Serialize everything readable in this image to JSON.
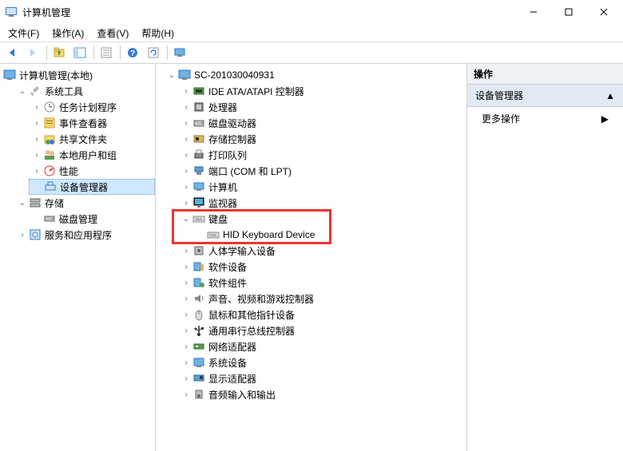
{
  "window": {
    "title": "计算机管理",
    "minimize": "–",
    "maximize": "☐",
    "close": "✕"
  },
  "menu": {
    "file": "文件(F)",
    "action": "操作(A)",
    "view": "查看(V)",
    "help": "帮助(H)"
  },
  "left_tree": {
    "root": "计算机管理(本地)",
    "sys_tools": "系统工具",
    "task_scheduler": "任务计划程序",
    "event_viewer": "事件查看器",
    "shared_folders": "共享文件夹",
    "local_users": "本地用户和组",
    "performance": "性能",
    "device_mgr": "设备管理器",
    "storage": "存储",
    "disk_mgmt": "磁盘管理",
    "services_apps": "服务和应用程序"
  },
  "center_tree": {
    "root": "SC-201030040931",
    "ide": "IDE ATA/ATAPI 控制器",
    "cpu": "处理器",
    "disk_drives": "磁盘驱动器",
    "storage_ctrl": "存储控制器",
    "print_queue": "打印队列",
    "ports": "端口 (COM 和 LPT)",
    "computer": "计算机",
    "monitors": "监视器",
    "keyboard": "键盘",
    "hid_keyboard": "HID Keyboard Device",
    "hid": "人体学输入设备",
    "software_dev": "软件设备",
    "software_comp": "软件组件",
    "sound": "声音、视频和游戏控制器",
    "mouse": "鼠标和其他指针设备",
    "usb": "通用串行总线控制器",
    "network": "网络适配器",
    "system_dev": "系统设备",
    "display": "显示适配器",
    "audio_io": "音频输入和输出"
  },
  "right_panel": {
    "header": "操作",
    "section": "设备管理器",
    "more_actions": "更多操作"
  }
}
